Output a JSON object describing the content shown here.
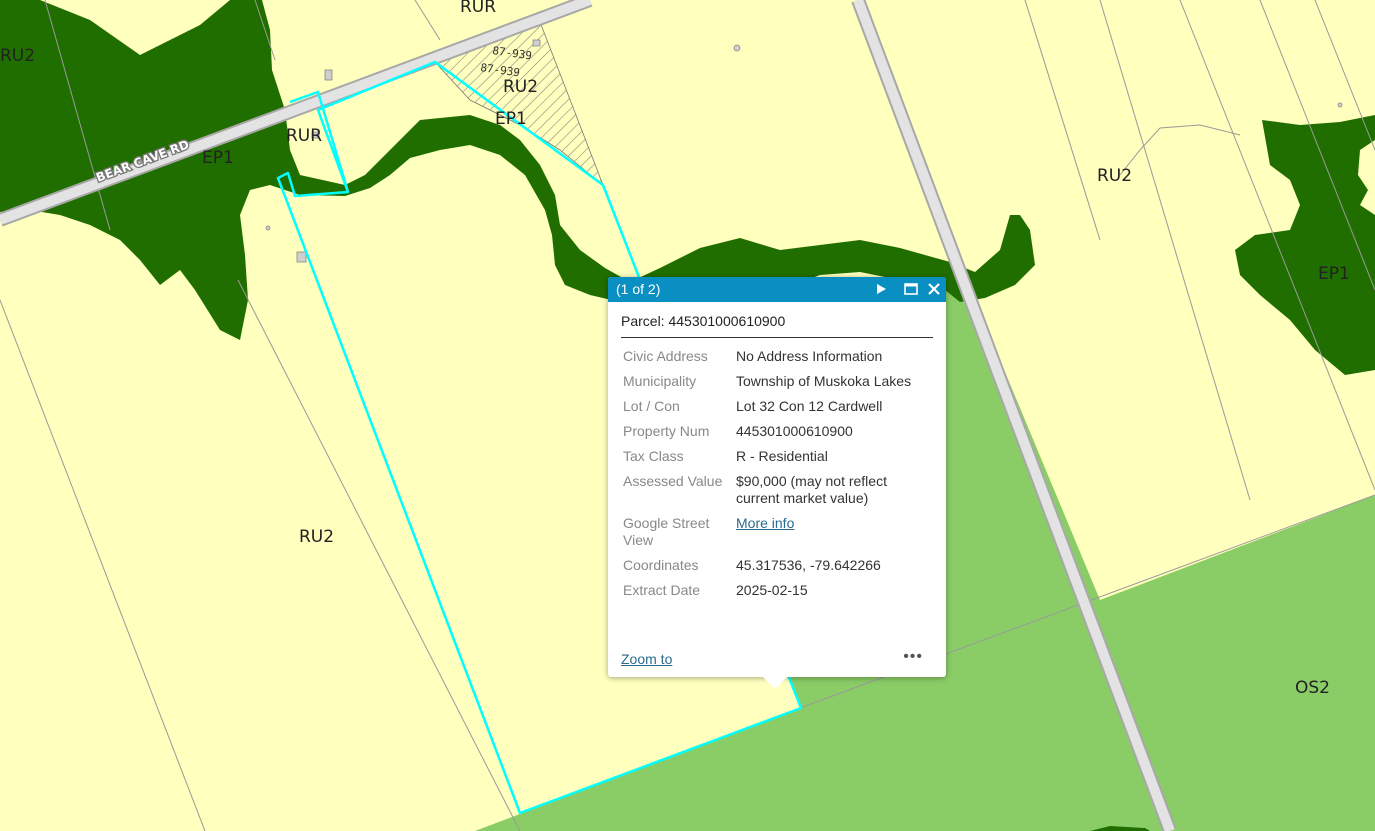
{
  "map": {
    "zone_labels": [
      "RU2",
      "RUR",
      "RU2",
      "EP1",
      "RUR",
      "EP1",
      "RU2",
      "EP1",
      "RU2",
      "OS2"
    ],
    "road_label": "BEAR CAVE RD",
    "bylaw_labels": [
      "87-939",
      "87-939"
    ],
    "colors": {
      "rural": "#ffffbe",
      "environmental_protection": "#216e00",
      "open_space": "#8acc66",
      "road": "#d9d9d9",
      "selection": "#00ffff"
    }
  },
  "popup": {
    "header": {
      "title": "(1 of 2)",
      "next_icon": "play-icon",
      "maximize_icon": "maximize-icon",
      "close_icon": "close-icon"
    },
    "parcel_title": "Parcel: 445301000610900",
    "attributes": [
      {
        "key": "Civic Address",
        "value": "No Address Information"
      },
      {
        "key": "Municipality",
        "value": "Township of Muskoka Lakes"
      },
      {
        "key": "Lot / Con",
        "value": "Lot 32 Con 12 Cardwell"
      },
      {
        "key": "Property Num",
        "value": "445301000610900"
      },
      {
        "key": "Tax Class",
        "value": "R - Residential"
      },
      {
        "key": "Assessed Value",
        "value": "$90,000 (may not reflect current market value)"
      },
      {
        "key": "Google Street View",
        "value": "More info"
      },
      {
        "key": "Coordinates",
        "value": "45.317536, -79.642266"
      },
      {
        "key": "Extract Date",
        "value": "2025-02-15"
      }
    ],
    "footer": {
      "zoom_to": "Zoom to",
      "more": "•••"
    }
  }
}
